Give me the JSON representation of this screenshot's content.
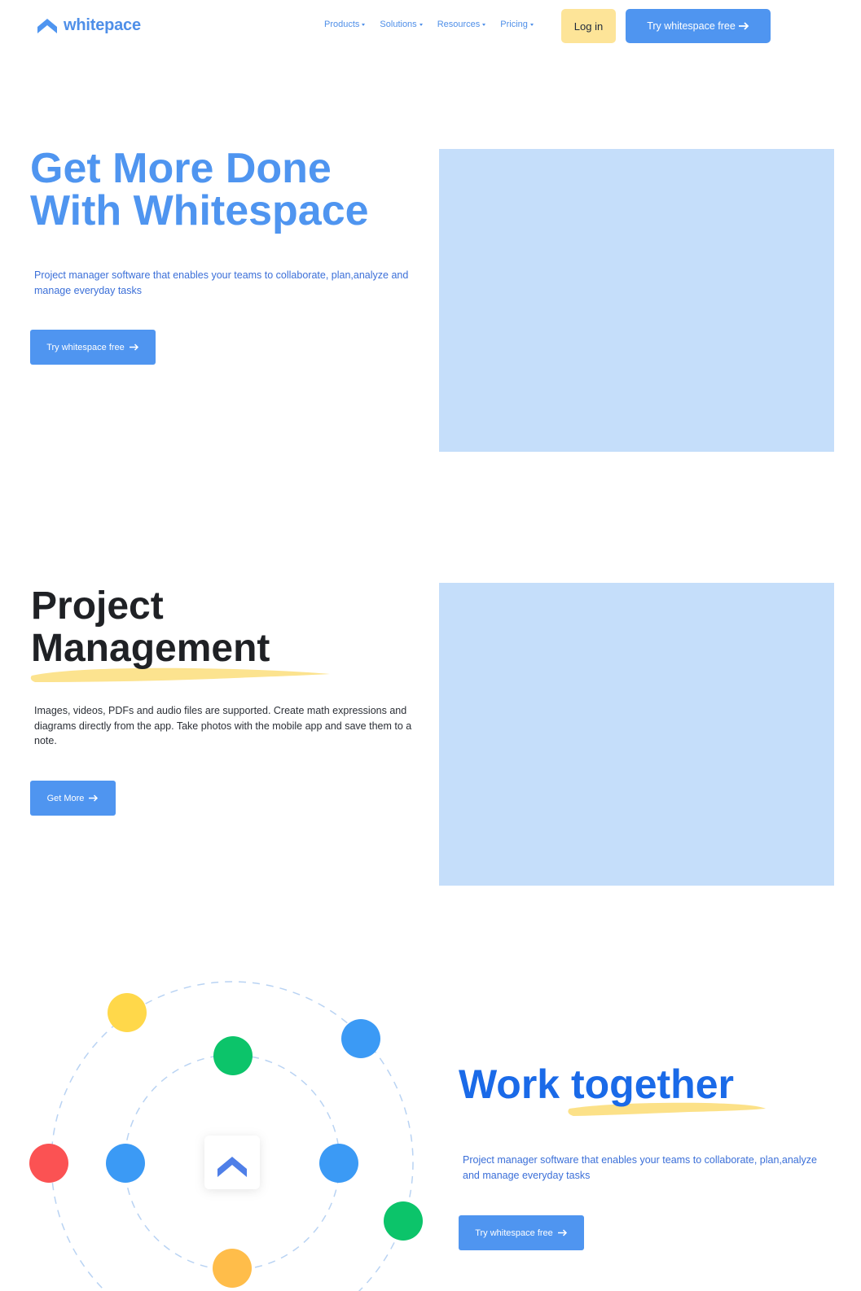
{
  "brand": {
    "name": "whitepace",
    "logo_icon": "chevron-up-logo-icon",
    "color": "#4f95f0"
  },
  "nav": {
    "items": [
      {
        "label": "Products"
      },
      {
        "label": "Solutions"
      },
      {
        "label": "Resources"
      },
      {
        "label": "Pricing"
      }
    ],
    "login_label": "Log in",
    "try_label": "Try whitespace free"
  },
  "hero": {
    "title_line1": "Get More Done",
    "title_line2": "With Whitespace",
    "description": "Project manager software that enables your teams to collaborate, plan,analyze and manage everyday tasks",
    "cta_label": "Try whitespace free"
  },
  "project_management": {
    "title_line1": "Project",
    "title_line2": "Management",
    "description": "Images, videos, PDFs and audio files are supported. Create math expressions and diagrams directly from the app. Take photos with the mobile app and save them to a note.",
    "cta_label": "Get More"
  },
  "work_together": {
    "title": "Work together",
    "description": "Project manager software that enables your teams to collaborate, plan,analyze and manage everyday tasks",
    "cta_label": "Try whitespace free"
  },
  "colors": {
    "accent": "#4f95f0",
    "login_bg": "#fde498",
    "placeholder": "#c5defa",
    "highlight": "#fbd96a",
    "dot_yellow": "#ffd84a",
    "dot_blue": "#3b9af5",
    "dot_green": "#0cc46a",
    "dot_red": "#fb5253",
    "dot_orange": "#ffbd4a"
  }
}
